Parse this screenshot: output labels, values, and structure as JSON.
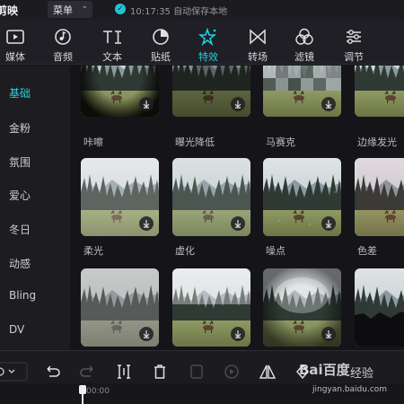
{
  "app": {
    "title": "剪映",
    "menu_label": "菜单",
    "save_status": "10:17:35 自动保存本地"
  },
  "toolbar": [
    {
      "label": "媒体",
      "icon": "media-icon"
    },
    {
      "label": "音频",
      "icon": "audio-icon"
    },
    {
      "label": "文本",
      "icon": "text-icon"
    },
    {
      "label": "贴纸",
      "icon": "sticker-icon"
    },
    {
      "label": "特效",
      "icon": "effects-icon",
      "active": true
    },
    {
      "label": "转场",
      "icon": "transition-icon"
    },
    {
      "label": "滤镜",
      "icon": "filter-icon"
    },
    {
      "label": "调节",
      "icon": "adjust-icon"
    }
  ],
  "categories": [
    {
      "label": "基础",
      "active": true
    },
    {
      "label": "金粉"
    },
    {
      "label": "氛围"
    },
    {
      "label": "爱心"
    },
    {
      "label": "冬日"
    },
    {
      "label": "动感"
    },
    {
      "label": "Bling"
    },
    {
      "label": "DV"
    }
  ],
  "effects": {
    "row1": [
      "咔嚓",
      "曝光降低",
      "马赛克",
      "边缘发光"
    ],
    "row2": [
      "柔光",
      "虚化",
      "噪点",
      "色差"
    ],
    "row3": [
      "",
      "",
      "",
      ""
    ]
  },
  "timeline": {
    "timecode": "00:00"
  },
  "watermark": {
    "logo": "Bai百度",
    "text": "经验",
    "url": "jingyan.baidu.com"
  },
  "colors": {
    "accent": "#22d3e0",
    "background": "#151519",
    "panel": "#1c1c21"
  }
}
